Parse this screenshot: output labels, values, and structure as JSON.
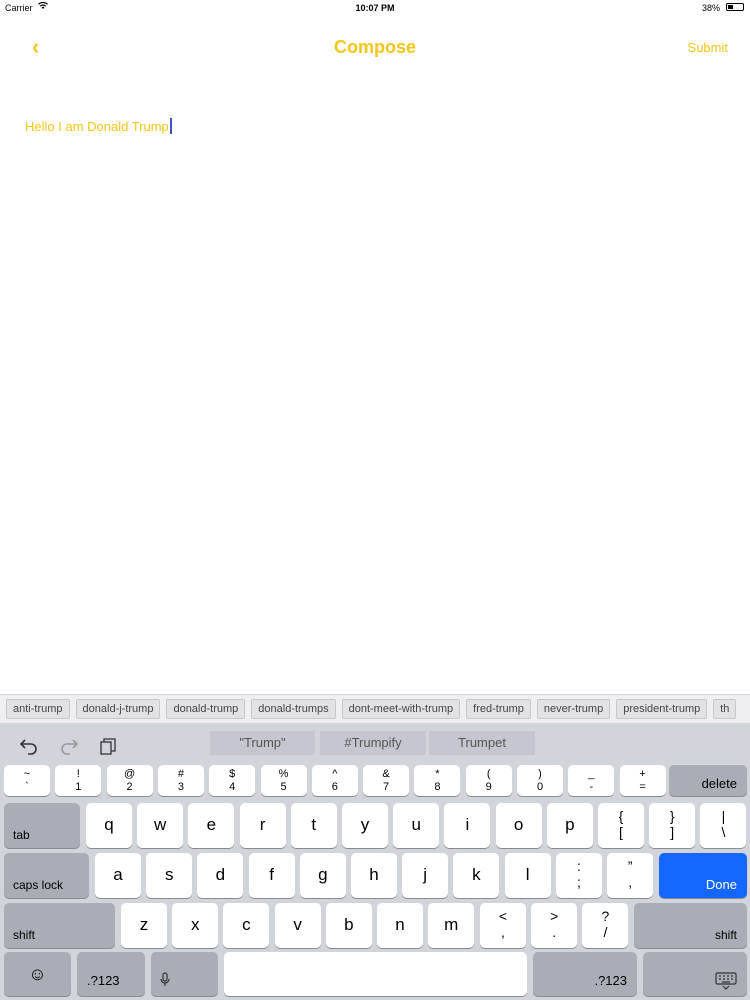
{
  "status_bar": {
    "carrier": "Carrier",
    "time": "10:07 PM",
    "battery": "38%",
    "battery_level": 0.38
  },
  "nav": {
    "back_icon": "chevron-left-icon",
    "back_glyph": "‹",
    "title": "Compose",
    "submit_label": "Submit"
  },
  "compose": {
    "text": "Hello I am Donald Trump"
  },
  "tags": [
    "anti-trump",
    "donald-j-trump",
    "donald-trump",
    "donald-trumps",
    "dont-meet-with-trump",
    "fred-trump",
    "never-trump",
    "president-trump",
    "th"
  ],
  "keyboard": {
    "undo_icon": "undo-icon",
    "redo_icon": "redo-icon",
    "paste_icon": "paste-icon",
    "suggestions": [
      "\"Trump\"",
      "#Trumpify",
      "Trumpet"
    ],
    "number_row": [
      [
        "~",
        "`"
      ],
      [
        "!",
        "1"
      ],
      [
        "@",
        "2"
      ],
      [
        "#",
        "3"
      ],
      [
        "$",
        "4"
      ],
      [
        "%",
        "5"
      ],
      [
        "^",
        "6"
      ],
      [
        "&",
        "7"
      ],
      [
        "*",
        "8"
      ],
      [
        "(",
        "9"
      ],
      [
        ")",
        "0"
      ],
      [
        "_",
        "-"
      ],
      [
        "+",
        "="
      ]
    ],
    "delete_label": "delete",
    "tab_label": "tab",
    "row_q": [
      "q",
      "w",
      "e",
      "r",
      "t",
      "y",
      "u",
      "i",
      "o",
      "p"
    ],
    "row_q_sym": [
      [
        "{",
        "["
      ],
      [
        "}",
        "]"
      ],
      [
        "|",
        "\\"
      ]
    ],
    "caps_label": "caps lock",
    "row_a": [
      "a",
      "s",
      "d",
      "f",
      "g",
      "h",
      "j",
      "k",
      "l"
    ],
    "row_a_sym": [
      [
        ":",
        ";"
      ],
      [
        "”",
        ","
      ]
    ],
    "done_label": "Done",
    "shift_label": "shift",
    "row_z": [
      "z",
      "x",
      "c",
      "v",
      "b",
      "n",
      "m"
    ],
    "row_z_sym": [
      [
        "<",
        ","
      ],
      [
        ">",
        "."
      ],
      [
        "?",
        "/"
      ]
    ],
    "emoji_glyph": "☺",
    "num_label": ".?123",
    "mic_icon": "microphone-icon",
    "hide_icon": "keyboard-hide-icon"
  },
  "colors": {
    "accent": "#f5c518",
    "done_key": "#1566ff"
  }
}
